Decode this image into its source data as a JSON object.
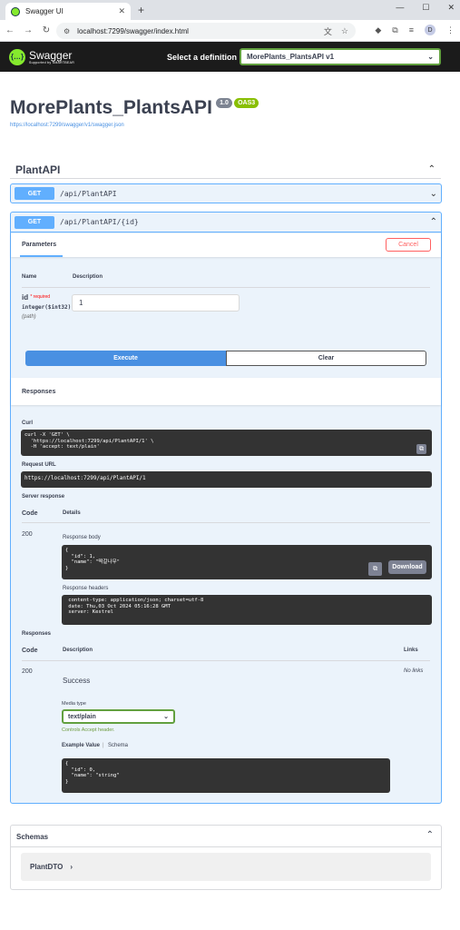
{
  "browser": {
    "tab_title": "Swagger UI",
    "url": "localhost:7299/swagger/index.html"
  },
  "topbar": {
    "logo_text": "Swagger",
    "logo_sub": "Supported by SMARTBEAR",
    "select_label": "Select a definition",
    "definition": "MorePlants_PlantsAPI v1"
  },
  "info": {
    "title": "MorePlants_PlantsAPI",
    "version": "1.0",
    "oas": "OAS3",
    "json_url": "https://localhost:7299/swagger/v1/swagger.json"
  },
  "tag": {
    "name": "PlantAPI"
  },
  "ops": [
    {
      "method": "GET",
      "path": "/api/PlantAPI"
    },
    {
      "method": "GET",
      "path": "/api/PlantAPI/{id}"
    }
  ],
  "params": {
    "tab": "Parameters",
    "cancel": "Cancel",
    "col_name": "Name",
    "col_desc": "Description",
    "name": "id",
    "required": "* required",
    "type": "integer($int32)",
    "in": "(path)",
    "value": "1",
    "execute": "Execute",
    "clear": "Clear"
  },
  "responses": {
    "header": "Responses",
    "curl_label": "Curl",
    "curl_text": "curl -X 'GET' \\\n  'https://localhost:7299/api/PlantAPI/1' \\\n  -H 'accept: text/plain'",
    "request_url_label": "Request URL",
    "request_url": "https://localhost:7299/api/PlantAPI/1",
    "server_response_label": "Server response",
    "col_code": "Code",
    "col_details": "Details",
    "code": "200",
    "body_label": "Response body",
    "body_text": "{\n  \"id\": 1,\n  \"name\": \"떡갈나무\"\n}",
    "download": "Download",
    "headers_label": "Response headers",
    "headers_text": " content-type: application/json; charset=utf-8 \n date: Thu,03 Oct 2024 05:16:28 GMT \n server: Kestrel ",
    "responses_label": "Responses",
    "col_desc": "Description",
    "col_links": "Links",
    "doc_code": "200",
    "doc_desc": "Success",
    "no_links": "No links",
    "media_type_label": "Media type",
    "media_type": "text/plain",
    "media_note": "Controls Accept header.",
    "example_tab": "Example Value",
    "schema_tab": "Schema",
    "example_text": "{\n  \"id\": 0,\n  \"name\": \"string\"\n}"
  },
  "schemas": {
    "header": "Schemas",
    "model": "PlantDTO"
  }
}
